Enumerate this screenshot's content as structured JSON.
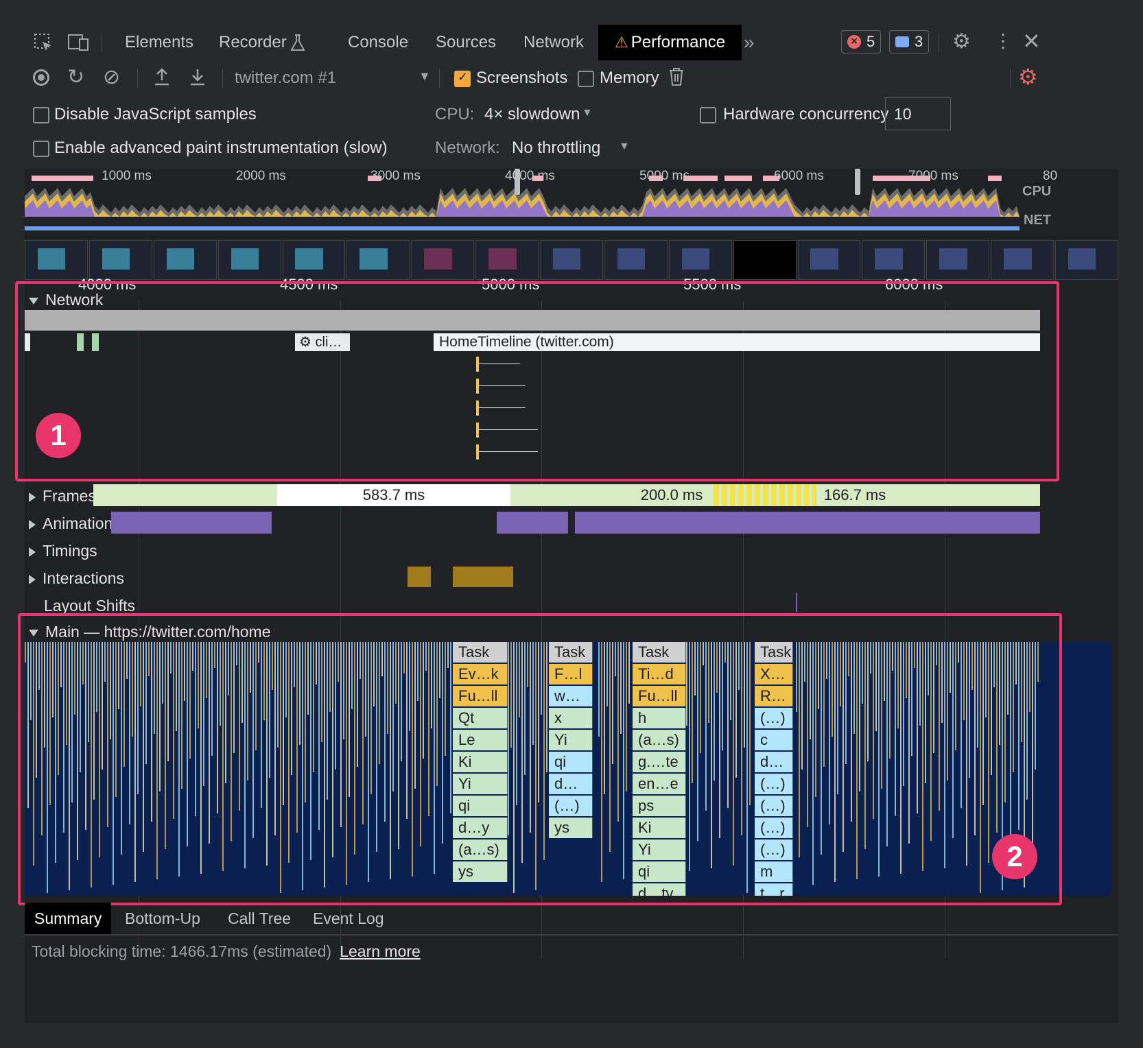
{
  "tabs": {
    "elements": "Elements",
    "recorder": "Recorder",
    "console": "Console",
    "sources": "Sources",
    "network": "Network",
    "performance": "Performance",
    "errors_count": "5",
    "messages_count": "3"
  },
  "toolbar": {
    "recording_select": "twitter.com #1",
    "screenshots_label": "Screenshots",
    "memory_label": "Memory"
  },
  "settings": {
    "disable_js_samples": "Disable JavaScript samples",
    "advanced_paint": "Enable advanced paint instrumentation (slow)",
    "cpu_label": "CPU:",
    "cpu_value": "4× slowdown",
    "network_label": "Network:",
    "network_value": "No throttling",
    "hw_concurrency_label": "Hardware concurrency",
    "hw_concurrency_value": "10"
  },
  "overview": {
    "ticks": [
      "1000 ms",
      "2000 ms",
      "3000 ms",
      "4000 ms",
      "5000 ms",
      "6000 ms",
      "7000 ms",
      "80"
    ],
    "cpu_label": "CPU",
    "net_label": "NET"
  },
  "ruler": {
    "ticks": [
      "4000 ms",
      "4500 ms",
      "5000 ms",
      "5500 ms",
      "6000 ms"
    ]
  },
  "network_track": {
    "label": "Network",
    "request_cli": "cli…",
    "request_home": "HomeTimeline (twitter.com)"
  },
  "tracks": {
    "frames": "Frames",
    "frame_583": "583.7 ms",
    "frame_200": "200.0 ms",
    "frame_166": "166.7 ms",
    "animation": "Animation",
    "timings": "Timings",
    "interactions": "Interactions",
    "layout_shifts": "Layout Shifts",
    "main": "Main — https://twitter.com/home"
  },
  "flame": {
    "col1": [
      "Task",
      "Ev…k",
      "Fu…ll",
      "Qt",
      "Le",
      "Ki",
      "Yi",
      "qi",
      "d…y",
      "(a…s)",
      "ys"
    ],
    "col2": [
      "Task",
      "F…l",
      "w…",
      "x",
      "Yi",
      "qi",
      "d…",
      "(…)",
      "ys"
    ],
    "col3": [
      "Task",
      "Ti…d",
      "Fu…ll",
      "h",
      "(a…s)",
      "g.…te",
      "en…e",
      "ps",
      "Ki",
      "Yi",
      "qi",
      "d…tv"
    ],
    "col4": [
      "Task",
      "X…",
      "R…",
      "(…)",
      "c",
      "d…",
      "(…)",
      "(…)",
      "(…)",
      "(…)",
      "m",
      "t…r"
    ]
  },
  "callouts": {
    "one": "1",
    "two": "2"
  },
  "bottom": {
    "summary": "Summary",
    "bottom_up": "Bottom-Up",
    "call_tree": "Call Tree",
    "event_log": "Event Log",
    "tbt": "Total blocking time: 1466.17ms (estimated)",
    "learn_more": "Learn more"
  },
  "colors": {
    "highlight": "#e8356c",
    "accent": "#f6a93b",
    "main_bg": "#0a2050"
  }
}
